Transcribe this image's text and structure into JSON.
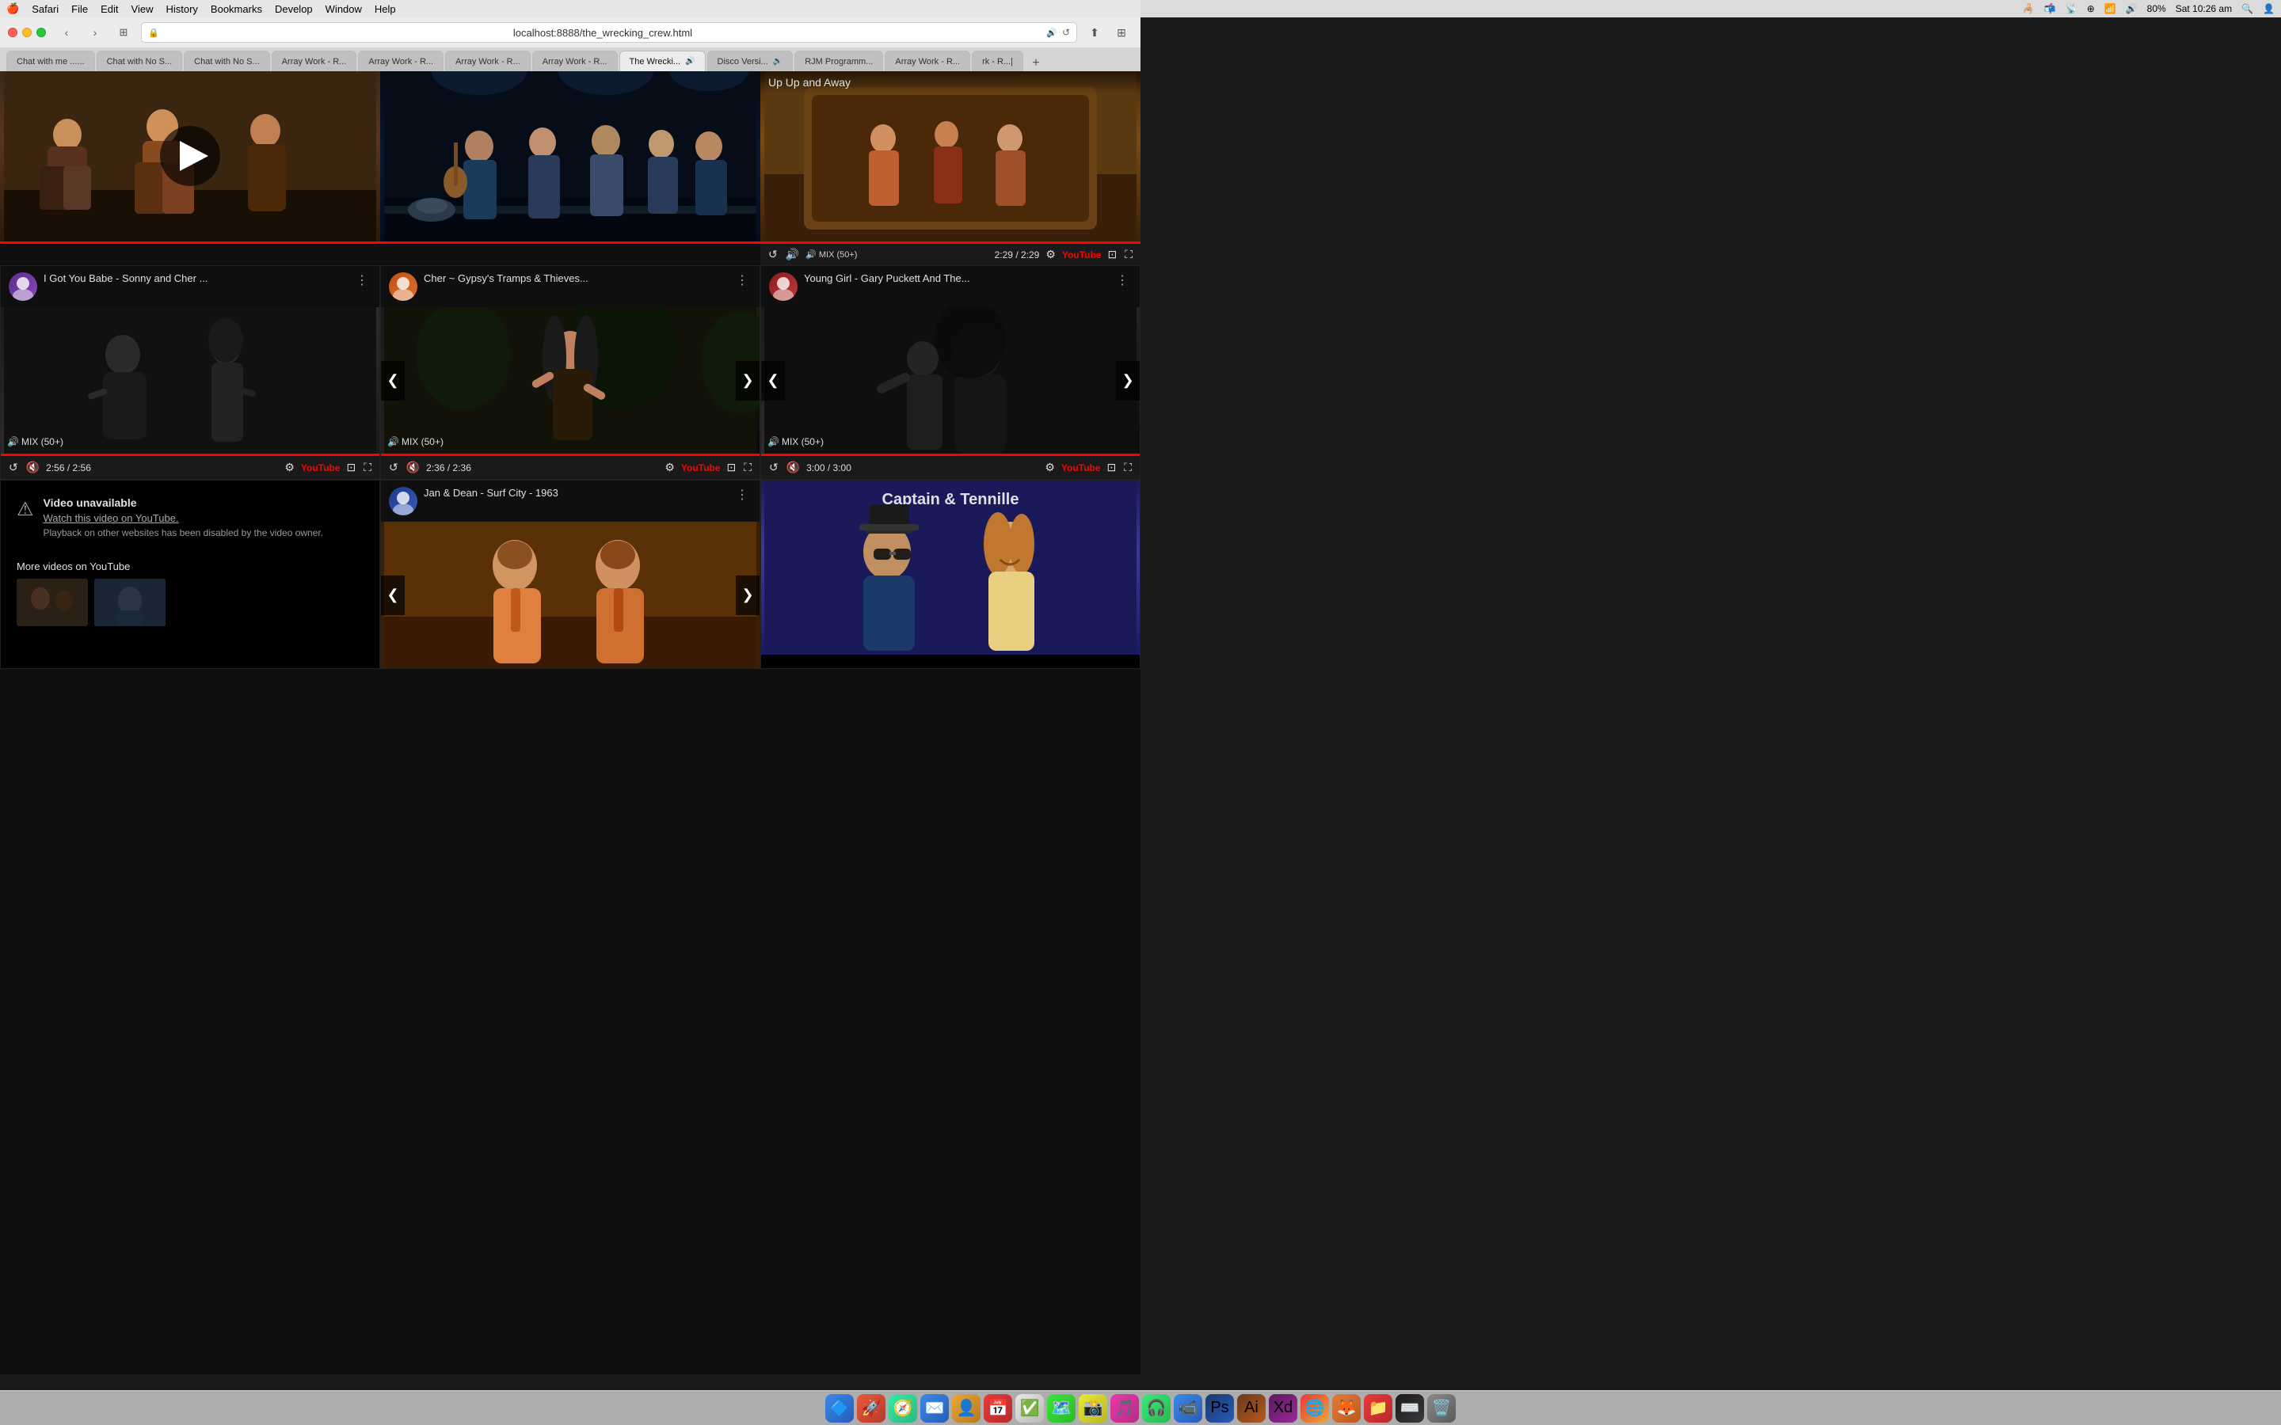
{
  "menuBar": {
    "apple": "🍎",
    "items": [
      "Safari",
      "File",
      "Edit",
      "View",
      "History",
      "Bookmarks",
      "Develop",
      "Window",
      "Help"
    ],
    "rightItems": {
      "battery": "80%",
      "time": "Sat 10:26 am"
    }
  },
  "browser": {
    "url": "localhost:8888/the_wrecking_crew.html",
    "tabs": [
      {
        "label": "Chat with me ......",
        "active": false,
        "audio": false
      },
      {
        "label": "Chat with No S...",
        "active": false,
        "audio": false
      },
      {
        "label": "Chat with No S...",
        "active": false,
        "audio": false
      },
      {
        "label": "Array Work - R...",
        "active": false,
        "audio": false
      },
      {
        "label": "Array Work - R...",
        "active": false,
        "audio": false
      },
      {
        "label": "Array Work - R...",
        "active": false,
        "audio": false
      },
      {
        "label": "Array Work - R...",
        "active": false,
        "audio": false
      },
      {
        "label": "The Wrecki...",
        "active": true,
        "audio": true
      },
      {
        "label": "Disco Versi...",
        "active": false,
        "audio": true
      },
      {
        "label": "RJM Programm...",
        "active": false,
        "audio": false
      },
      {
        "label": "Array Work - R...",
        "active": false,
        "audio": false
      },
      {
        "label": "rk - R...|",
        "active": false,
        "audio": false
      }
    ]
  },
  "topRow": {
    "cell1": {
      "type": "playing",
      "description": "Band video playing - brown/sepia tone"
    },
    "cell2": {
      "type": "playing",
      "description": "Stage performance - dark blue tones"
    },
    "cell3": {
      "overlayTitle": "Up Up and Away",
      "mixBadge": "MIX (50+)",
      "time": "2:29 / 2:29",
      "description": "TV show - brown/orange tones"
    }
  },
  "videos": [
    {
      "id": "v1",
      "title": "I Got You Babe - Sonny and Cher ...",
      "mixBadge": "MIX (50+)",
      "time": "2:56 / 2:56",
      "hasCarousel": false,
      "type": "sonny-cher"
    },
    {
      "id": "v2",
      "title": "Cher ~ Gypsy's Tramps & Thieves...",
      "mixBadge": "MIX (50+)",
      "time": "2:36 / 2:36",
      "hasCarousel": true,
      "type": "cher"
    },
    {
      "id": "v3",
      "title": "Young Girl - Gary Puckett And The...",
      "mixBadge": "MIX (50+)",
      "time": "3:00 / 3:00",
      "hasCarousel": true,
      "type": "young-girl"
    }
  ],
  "bottomRow": {
    "cell1": {
      "type": "unavailable",
      "title": "Video unavailable",
      "watchLink": "Watch this video on YouTube.",
      "description": "Playback on other websites has been disabled by the video owner.",
      "moreVideosLabel": "More videos on YouTube"
    },
    "cell2": {
      "title": "Jan & Dean - Surf City - 1963",
      "hasCarousel": true,
      "type": "jan-dean"
    },
    "cell3": {
      "type": "captain-tennille",
      "description": "Captain & Tennille thumbnail"
    }
  },
  "icons": {
    "play": "▶",
    "pause": "⏸",
    "replay": "↺",
    "mute": "🔇",
    "settings": "⚙",
    "cast": "⊡",
    "fullscreen": "⛶",
    "more": "⋮",
    "chevronLeft": "❮",
    "chevronRight": "❯",
    "alert": "⚠",
    "volume": "🔊"
  },
  "colors": {
    "ytRed": "#ff0000",
    "darkBg": "#0f0f0f",
    "controlsBg": "#1a1a1a",
    "textLight": "#e0e0e0",
    "textMuted": "#aaa"
  }
}
